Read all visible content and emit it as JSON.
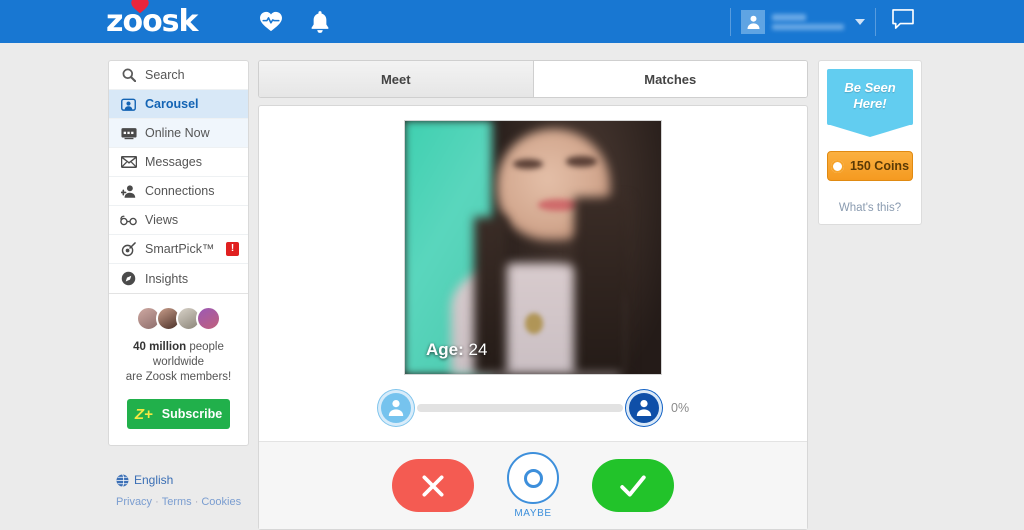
{
  "brand": {
    "name": "zoosk",
    "header_color": "#1877d2"
  },
  "header": {
    "icons": [
      {
        "name": "heartbeat-icon"
      },
      {
        "name": "bell-icon"
      }
    ],
    "user": {
      "name_redacted": "",
      "location_redacted": ""
    },
    "chat_icon": "chat-bubble-icon"
  },
  "sidebar": {
    "items": [
      {
        "label": "Search",
        "icon": "search-icon",
        "active": false,
        "badge": ""
      },
      {
        "label": "Carousel",
        "icon": "carousel-icon",
        "active": true,
        "badge": ""
      },
      {
        "label": "Online Now",
        "icon": "online-now-icon",
        "active": false,
        "badge": ""
      },
      {
        "label": "Messages",
        "icon": "envelope-icon",
        "active": false,
        "badge": ""
      },
      {
        "label": "Connections",
        "icon": "add-person-icon",
        "active": false,
        "badge": ""
      },
      {
        "label": "Views",
        "icon": "glasses-icon",
        "active": false,
        "badge": ""
      },
      {
        "label": "SmartPick™",
        "icon": "target-icon",
        "active": false,
        "badge": "!"
      },
      {
        "label": "Insights",
        "icon": "compass-icon",
        "active": false,
        "badge": ""
      }
    ],
    "promo": {
      "count": "40 million",
      "text_rest": " people worldwide",
      "line2": "are Zoosk members!",
      "subscribe_label": "Subscribe",
      "subscribe_mark": "Z+",
      "subscribe_color": "#21b04b"
    }
  },
  "footer": {
    "language": "English",
    "links": [
      "Privacy",
      "Terms",
      "Cookies"
    ],
    "separator": "·"
  },
  "main": {
    "tabs": [
      {
        "label": "Meet",
        "active": true
      },
      {
        "label": "Matches",
        "active": false
      }
    ],
    "profile": {
      "age_label": "Age:",
      "age_value": "24"
    },
    "progress": {
      "percent_label": "0%",
      "percent_value": 0
    },
    "actions": {
      "no_label": "✕",
      "maybe_label": "MAYBE",
      "yes_label": "✓",
      "no_color": "#f45b52",
      "maybe_color": "#3d8fdb",
      "yes_color": "#22c32a"
    }
  },
  "rail": {
    "ribbon_line1": "Be Seen",
    "ribbon_line2": "Here!",
    "ribbon_color": "#62cdf0",
    "coins_label": "150 Coins",
    "coins_color": "#f59a20",
    "whats_this": "What's this?"
  }
}
